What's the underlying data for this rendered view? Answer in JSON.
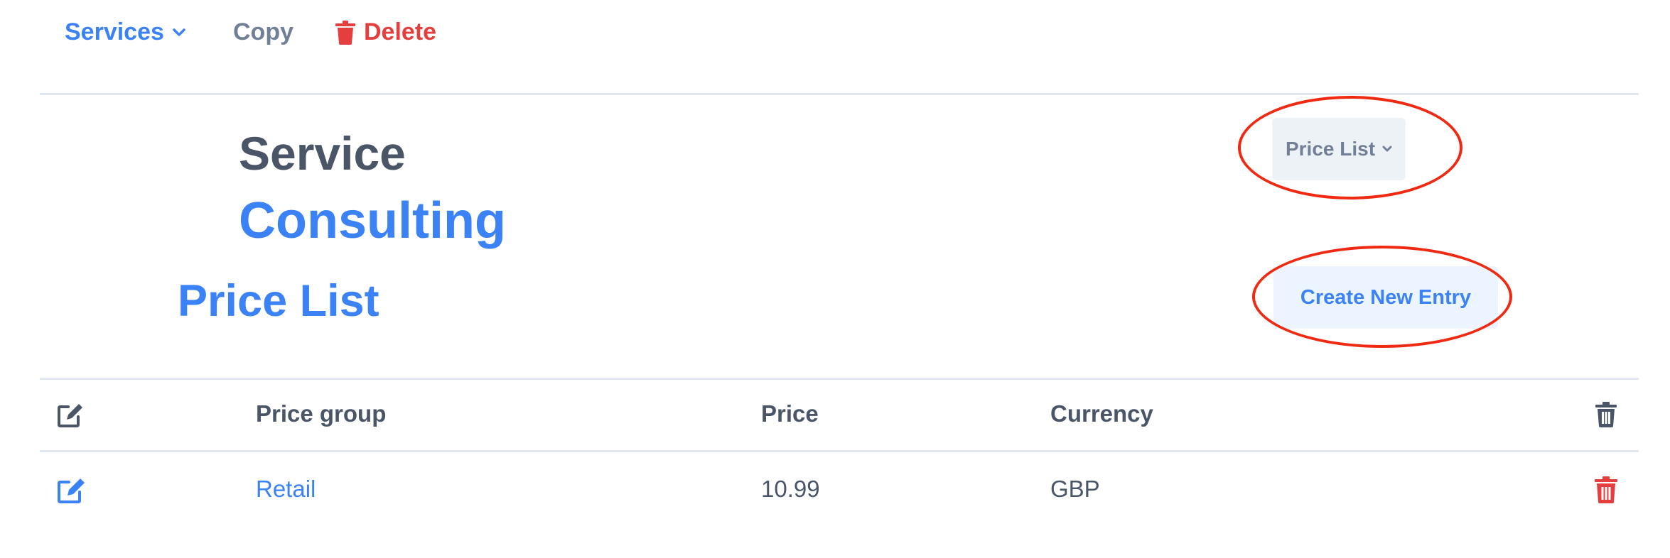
{
  "nav": {
    "services_label": "Services",
    "copy_label": "Copy",
    "delete_label": "Delete"
  },
  "header": {
    "entity_type": "Service",
    "entity_name": "Consulting",
    "section_title": "Price List"
  },
  "actions": {
    "price_list_dropdown": "Price List",
    "create_new_entry": "Create New Entry"
  },
  "table": {
    "columns": [
      "Price group",
      "Price",
      "Currency"
    ],
    "rows": [
      {
        "price_group": "Retail",
        "price": "10.99",
        "currency": "GBP"
      }
    ]
  },
  "colors": {
    "accent": "#3b82f6",
    "danger": "#e53e3e",
    "muted": "#718096",
    "annotation": "#f02a12"
  },
  "icons": {
    "services_chevron": "chevron-down-icon",
    "delete": "trash-icon",
    "header_edit": "edit-icon",
    "header_delete": "trash-icon",
    "row_edit": "edit-icon",
    "row_delete": "trash-icon"
  }
}
